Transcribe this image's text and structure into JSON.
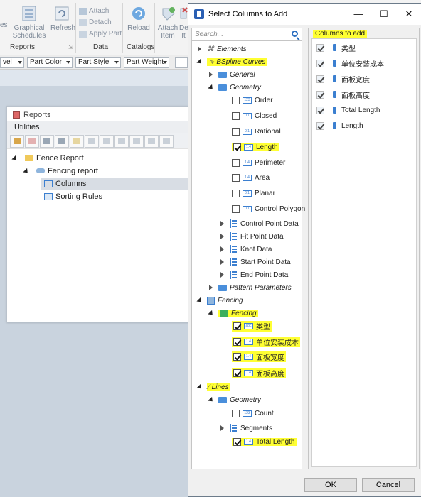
{
  "ribbon": {
    "graphical_schedules": "Graphical Schedules",
    "graphical_schedules_partial": "es",
    "refresh": "Refresh",
    "attach": "Attach",
    "detach": "Detach",
    "apply_part": "Apply Part",
    "reload": "Reload",
    "attach_item": "Attach Item",
    "de_partial": "De It",
    "groups": {
      "reports": "Reports",
      "data": "Data",
      "catalogs": "Catalogs"
    },
    "dropdowns": [
      "vel",
      "Part Color",
      "Part Style",
      "Part Weight"
    ]
  },
  "reports_panel": {
    "title": "Reports",
    "utilities": "Utilities",
    "tree": {
      "fence_report": "Fence Report",
      "fencing_report": "Fencing report",
      "columns": "Columns",
      "sorting_rules": "Sorting Rules"
    }
  },
  "dialog": {
    "title": "Select Columns to Add",
    "search_placeholder": "Search...",
    "tree": {
      "elements": "Elements",
      "bspline_curves": "BSpline Curves",
      "general": "General",
      "geometry": "Geometry",
      "order": "Order",
      "closed": "Closed",
      "rational": "Rational",
      "length": "Length",
      "perimeter": "Perimeter",
      "area": "Area",
      "planar": "Planar",
      "control_polygon": "Control Polygon",
      "control_point_data": "Control Point Data",
      "fit_point_data": "Fit Point Data",
      "knot_data": "Knot Data",
      "start_point_data": "Start Point Data",
      "end_point_data": "End Point Data",
      "pattern_parameters": "Pattern Parameters",
      "fencing_root": "Fencing",
      "fencing_child": "Fencing",
      "type_cn": "类型",
      "unit_cost_cn": "单位安装成本",
      "panel_width_cn": "面板宽度",
      "panel_height_cn": "面板高度",
      "lines": "Lines",
      "geometry2": "Geometry",
      "count": "Count",
      "segments": "Segments",
      "total_length": "Total Length"
    },
    "columns_to_add_label": "Columns to add",
    "columns_to_add": [
      "类型",
      "单位安装成本",
      "面板宽度",
      "面板高度",
      "Total Length",
      "Length"
    ],
    "ok": "OK",
    "cancel": "Cancel",
    "window_controls": {
      "minimize": "—",
      "maximize": "☐",
      "close": "✕"
    }
  },
  "colors": {
    "highlight": "#ffff33",
    "accent": "#2d6fc0"
  }
}
